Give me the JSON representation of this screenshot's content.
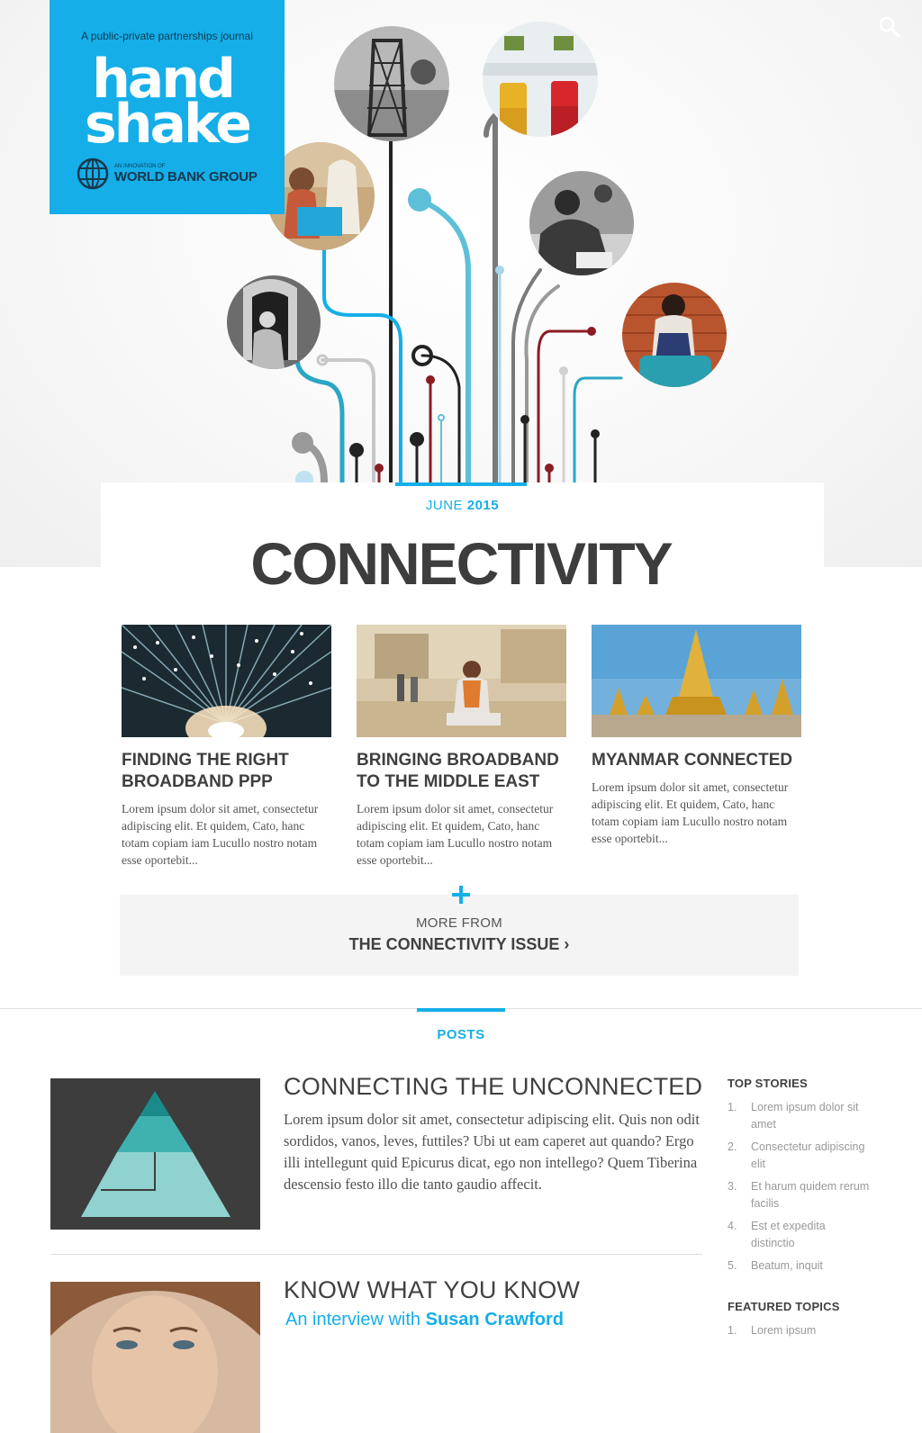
{
  "header": {
    "tagline": "A public-private partnerships journal",
    "logo_word_1": "hand",
    "logo_word_2": "shake",
    "publisher_sub": "AN INNOVATION OF",
    "publisher_name": "WORLD BANK GROUP",
    "search_icon": "search-icon",
    "brand_color": "#15aee8"
  },
  "issue": {
    "month": "JUNE",
    "year": "2015",
    "title": "CONNECTIVITY"
  },
  "features": [
    {
      "title": "FINDING THE RIGHT BROADBAND PPP",
      "excerpt": "Lorem ipsum dolor sit amet, consectetur adipiscing elit. Et quidem, Cato, hanc totam copiam iam Lucullo nostro notam esse oportebit..."
    },
    {
      "title": "BRINGING BROADBAND TO THE MIDDLE EAST",
      "excerpt": "Lorem ipsum dolor sit amet, consectetur adipiscing elit. Et quidem, Cato, hanc totam copiam iam Lucullo nostro notam esse oportebit..."
    },
    {
      "title": "MYANMAR CONNECTED",
      "excerpt": "Lorem ipsum dolor sit amet, consectetur adipiscing elit. Et quidem, Cato, hanc totam copiam iam Lucullo nostro notam esse oportebit..."
    }
  ],
  "more": {
    "icon": "plus-icon",
    "label": "MORE FROM",
    "link": "THE CONNECTIVITY ISSUE ›"
  },
  "posts_section": {
    "label": "POSTS"
  },
  "posts": [
    {
      "title": "CONNECTING THE UNCONNECTED",
      "excerpt": "Lorem ipsum dolor sit amet, consectetur adipiscing elit. Quis non odit sordidos, vanos, leves, futtiles? Ubi ut eam caperet aut quando? Ergo illi intellegunt quid Epicurus dicat, ego non intellego? Quem Tiberina descensio festo illo die tanto gaudio affecit."
    },
    {
      "title": "KNOW WHAT YOU KNOW",
      "subtitle_prefix": "An interview with",
      "subtitle_name": "Susan Crawford"
    }
  ],
  "sidebar": {
    "top_stories_heading": "TOP STORIES",
    "top_stories": [
      {
        "num": "1.",
        "text": "Lorem ipsum dolor sit amet"
      },
      {
        "num": "2.",
        "text": "Consectetur adipiscing elit"
      },
      {
        "num": "3.",
        "text": "Et harum quidem rerum facilis"
      },
      {
        "num": "4.",
        "text": "Est et expedita distinctio"
      },
      {
        "num": "5.",
        "text": "Beatum, inquit"
      }
    ],
    "featured_heading": "FEATURED TOPICS",
    "featured": [
      {
        "num": "1.",
        "text": "Lorem ipsum"
      }
    ]
  }
}
